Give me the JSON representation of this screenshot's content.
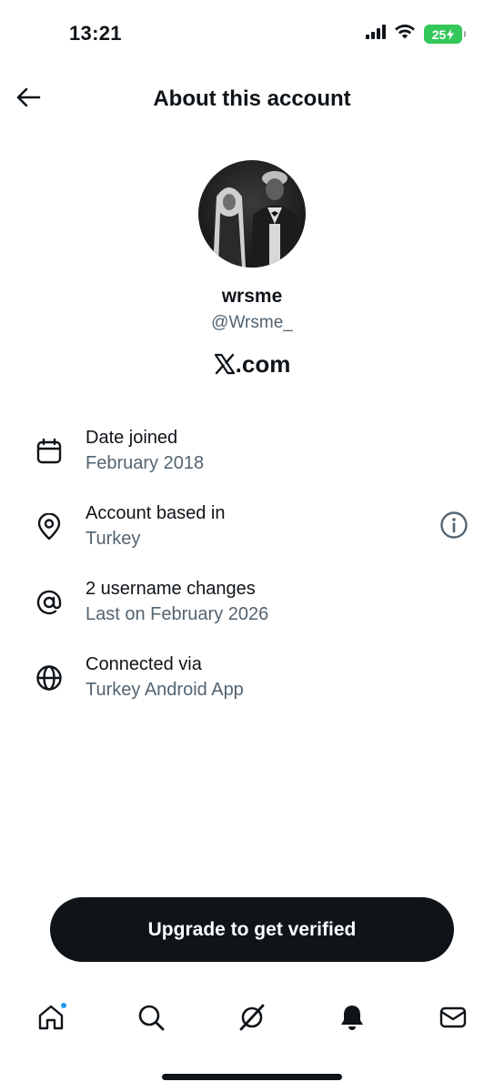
{
  "status_bar": {
    "time": "13:21",
    "battery": "25",
    "icons": [
      "signal-icon",
      "wifi-icon",
      "battery-icon"
    ],
    "battery_color": "#34c759"
  },
  "header": {
    "title": "About this account",
    "back_icon": "arrow-left-icon"
  },
  "profile": {
    "display_name": "wrsme",
    "handle": "@Wrsme_",
    "platform": ".com",
    "platform_logo": "x-logo-icon"
  },
  "info": {
    "items": [
      {
        "icon": "calendar-icon",
        "label": "Date joined",
        "value": "February 2018"
      },
      {
        "icon": "location-pin-icon",
        "label": "Account based in",
        "value": "Turkey",
        "action_icon": "info-icon"
      },
      {
        "icon": "at-sign-icon",
        "label": "2 username changes",
        "value": "Last on February 2026"
      },
      {
        "icon": "globe-icon",
        "label": "Connected via",
        "value": "Turkey Android App"
      }
    ]
  },
  "upgrade": {
    "label": "Upgrade to get verified"
  },
  "bottom_nav": {
    "items": [
      "home-icon",
      "search-icon",
      "grok-icon",
      "notifications-bell-icon",
      "messages-icon"
    ],
    "notification_dot_color": "#1d9bf0"
  },
  "colors": {
    "text_primary": "#0f1419",
    "text_secondary": "#536471",
    "button_bg": "#0f1419"
  }
}
